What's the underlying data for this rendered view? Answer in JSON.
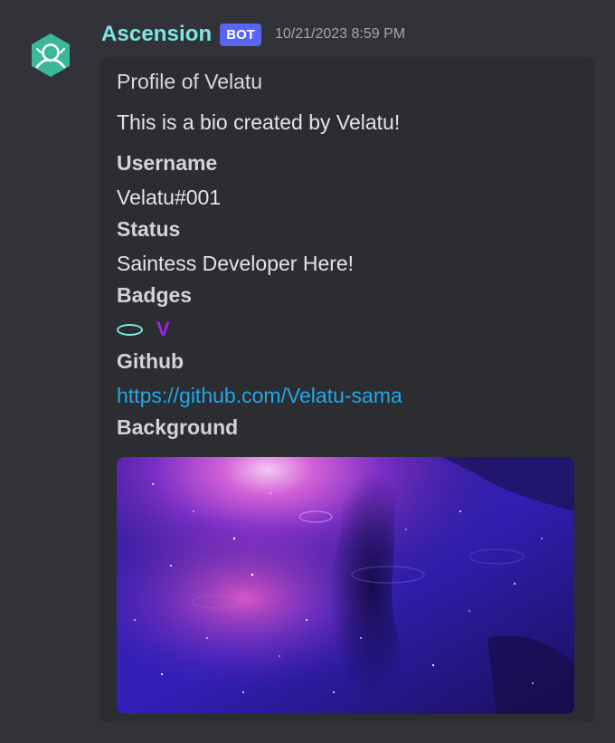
{
  "author": {
    "name": "Ascension",
    "bot_tag": "BOT",
    "timestamp": "10/21/2023 8:59 PM",
    "avatar_icon": "bot-avatar-icon",
    "name_color": "#7fe6e2"
  },
  "embed": {
    "title": "Profile of Velatu",
    "description": "This is a bio created by Velatu!",
    "fields": [
      {
        "name": "Username",
        "value": "Velatu#001"
      },
      {
        "name": "Status",
        "value": "Saintess Developer Here!"
      },
      {
        "name": "Badges",
        "value": "V"
      },
      {
        "name": "Github",
        "value": "https://github.com/Velatu-sama"
      },
      {
        "name": "Background",
        "value": ""
      }
    ],
    "badge_icons": [
      "oval-badge-icon",
      "v-badge"
    ],
    "image": "night-sky-reflection-image"
  },
  "colors": {
    "background": "#313338",
    "embed_background": "#2b2d31",
    "bot_tag": "#5865f2",
    "link": "#22a7ea",
    "badge_v": "#a020f0"
  }
}
